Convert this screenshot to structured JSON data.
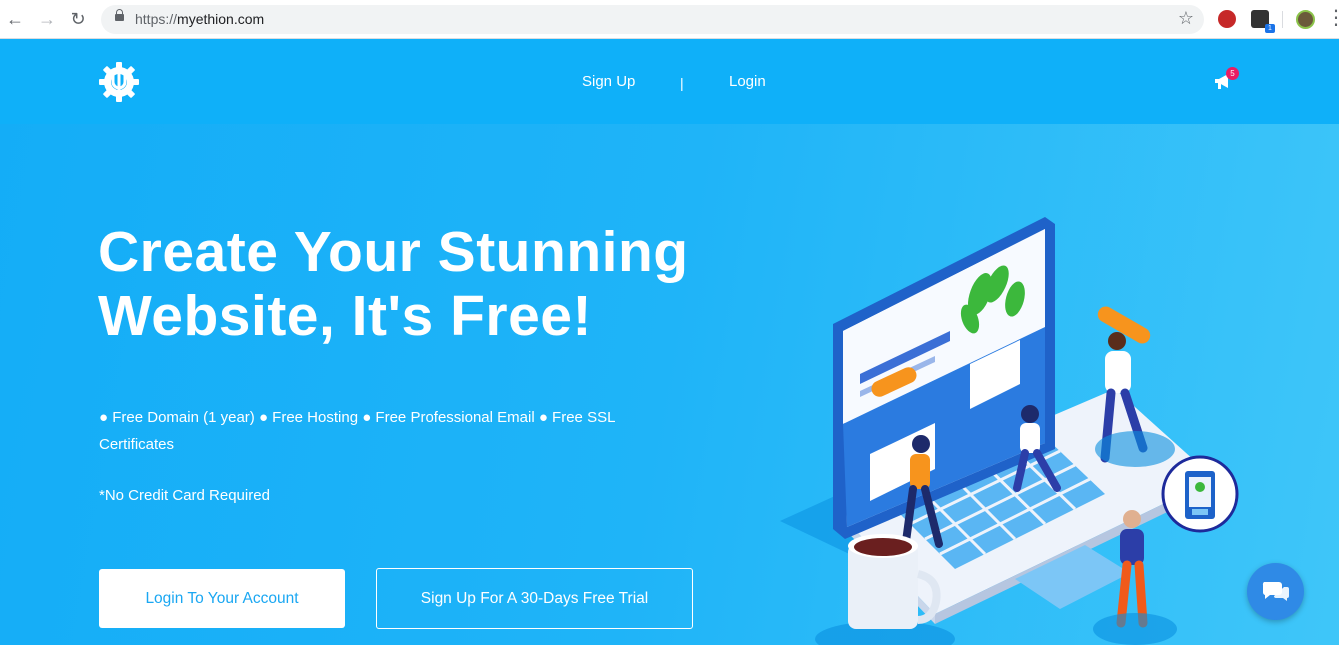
{
  "browser": {
    "url_scheme": "https://",
    "url_host": "myethion.com",
    "ext_badge": "1"
  },
  "header": {
    "signup_label": "Sign Up",
    "divider": "|",
    "login_label": "Login",
    "notification_count": "5"
  },
  "hero": {
    "title_line1": "Create Your Stunning",
    "title_line2": "Website, It's Free!",
    "features": "● Free Domain (1 year) ● Free Hosting ● Free Professional Email ● Free SSL Certificates",
    "no_card": "*No Credit Card Required",
    "login_button": "Login To Your Account",
    "signup_button": "Sign Up For A 30-Days Free Trial"
  },
  "colors": {
    "accent": "#1fb4f8",
    "header_bg": "#0fb0f9",
    "button_text": "#1aa7f2",
    "chat_bg": "#2f8ae6",
    "notif_badge": "#e91e63"
  },
  "icons": [
    "back-arrow-icon",
    "forward-arrow-icon",
    "reload-icon",
    "lock-icon",
    "star-icon",
    "extension-icon",
    "menu-icon",
    "gear-logo-icon",
    "megaphone-icon",
    "chat-icon"
  ]
}
